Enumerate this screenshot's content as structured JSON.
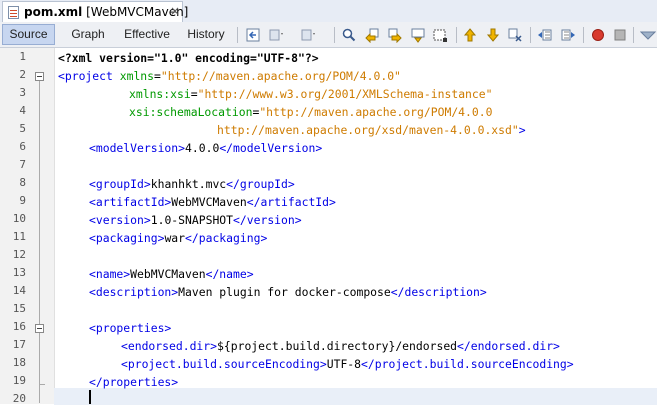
{
  "tab": {
    "filename": "pom.xml",
    "project": "[WebMVCMaven]",
    "close_glyph": "×"
  },
  "view_tabs": [
    "Source",
    "Graph",
    "Effective",
    "History"
  ],
  "toolbar_icons": [
    "last-edit-icon",
    "back-icon",
    "forward-icon",
    "find-icon",
    "find-previous-icon",
    "find-next-icon",
    "find-selection-icon",
    "toggle-highlight-icon",
    "previous-bookmark-icon",
    "next-bookmark-icon",
    "toggle-bookmark-icon",
    "shift-left-icon",
    "shift-right-icon",
    "start-macro-icon",
    "stop-macro-icon",
    "check-xml-icon"
  ],
  "line_numbers": [
    "1",
    "2",
    "3",
    "4",
    "5",
    "6",
    "7",
    "8",
    "9",
    "10",
    "11",
    "12",
    "13",
    "14",
    "15",
    "16",
    "17",
    "18",
    "19",
    "20"
  ],
  "code": {
    "l1": {
      "text": "<?xml version=\"1.0\" encoding=\"UTF-8\"?>"
    },
    "l2": {
      "open": "<project",
      "attr": "xmlns",
      "eq": "=",
      "val": "\"http://maven.apache.org/POM/4.0.0\""
    },
    "l3": {
      "attr": "xmlns:xsi",
      "eq": "=",
      "val": "\"http://www.w3.org/2001/XMLSchema-instance\""
    },
    "l4": {
      "attr": "xsi:schemaLocation",
      "eq": "=",
      "val": "\"http://maven.apache.org/POM/4.0.0"
    },
    "l5": {
      "val": "http://maven.apache.org/xsd/maven-4.0.0.xsd\"",
      "close": ">"
    },
    "l6": {
      "open": "<modelVersion>",
      "text": "4.0.0",
      "close": "</modelVersion>"
    },
    "l8": {
      "open": "<groupId>",
      "text": "khanhkt.mvc",
      "close": "</groupId>"
    },
    "l9": {
      "open": "<artifactId>",
      "text": "WebMVCMaven",
      "close": "</artifactId>"
    },
    "l10": {
      "open": "<version>",
      "text": "1.0-SNAPSHOT",
      "close": "</version>"
    },
    "l11": {
      "open": "<packaging>",
      "text": "war",
      "close": "</packaging>"
    },
    "l13": {
      "open": "<name>",
      "text": "WebMVCMaven",
      "close": "</name>"
    },
    "l14": {
      "open": "<description>",
      "text": "Maven plugin for docker-compose",
      "close": "</description>"
    },
    "l16": {
      "open": "<properties>"
    },
    "l17": {
      "open": "<endorsed.dir>",
      "text": "${project.build.directory}/endorsed",
      "close": "</endorsed.dir>"
    },
    "l18": {
      "open": "<project.build.sourceEncoding>",
      "text": "UTF-8",
      "close": "</project.build.sourceEncoding>"
    },
    "l19": {
      "close": "</properties>"
    }
  },
  "colors": {
    "tag": "#0000e6",
    "attribute": "#009900",
    "value": "#ce7b00",
    "active_view_tab": "#c7d6f0"
  }
}
